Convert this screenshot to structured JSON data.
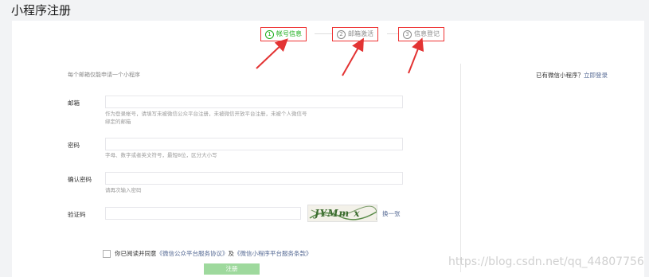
{
  "page_title": "小程序注册",
  "steps": [
    {
      "num": "1",
      "label": "帐号信息"
    },
    {
      "num": "2",
      "label": "邮箱激活"
    },
    {
      "num": "3",
      "label": "信息登记"
    }
  ],
  "hint": "每个邮箱仅能申请一个小程序",
  "login": {
    "text": "已有微信小程序？",
    "link": "立即登录"
  },
  "form": {
    "email": {
      "label": "邮箱",
      "value": "",
      "tip_line1": "作为登录帐号，请填写未被微信公众平台注册，未被微信开放平台注册，未被个人微信号",
      "tip_line2": "绑定的邮箱"
    },
    "password": {
      "label": "密码",
      "value": "",
      "tip": "字母、数字或者英文符号，最短8位，区分大小写"
    },
    "confirm": {
      "label": "确认密码",
      "value": "",
      "tip": "请再次输入密码"
    },
    "captcha": {
      "label": "验证码",
      "value": "",
      "change": "换一张",
      "image_text": "JYMm x"
    }
  },
  "agreement": {
    "prefix": "你已阅读并同意",
    "terms1": "《微信公众平台服务协议》",
    "and": "及",
    "terms2": "《微信小程序平台服务条款》"
  },
  "submit_label": "注册",
  "watermark": "https://blog.csdn.net/qq_44807756",
  "colors": {
    "accent": "#1aad19",
    "link": "#576b95",
    "annotation": "#e33333",
    "button": "#9ed99d"
  }
}
